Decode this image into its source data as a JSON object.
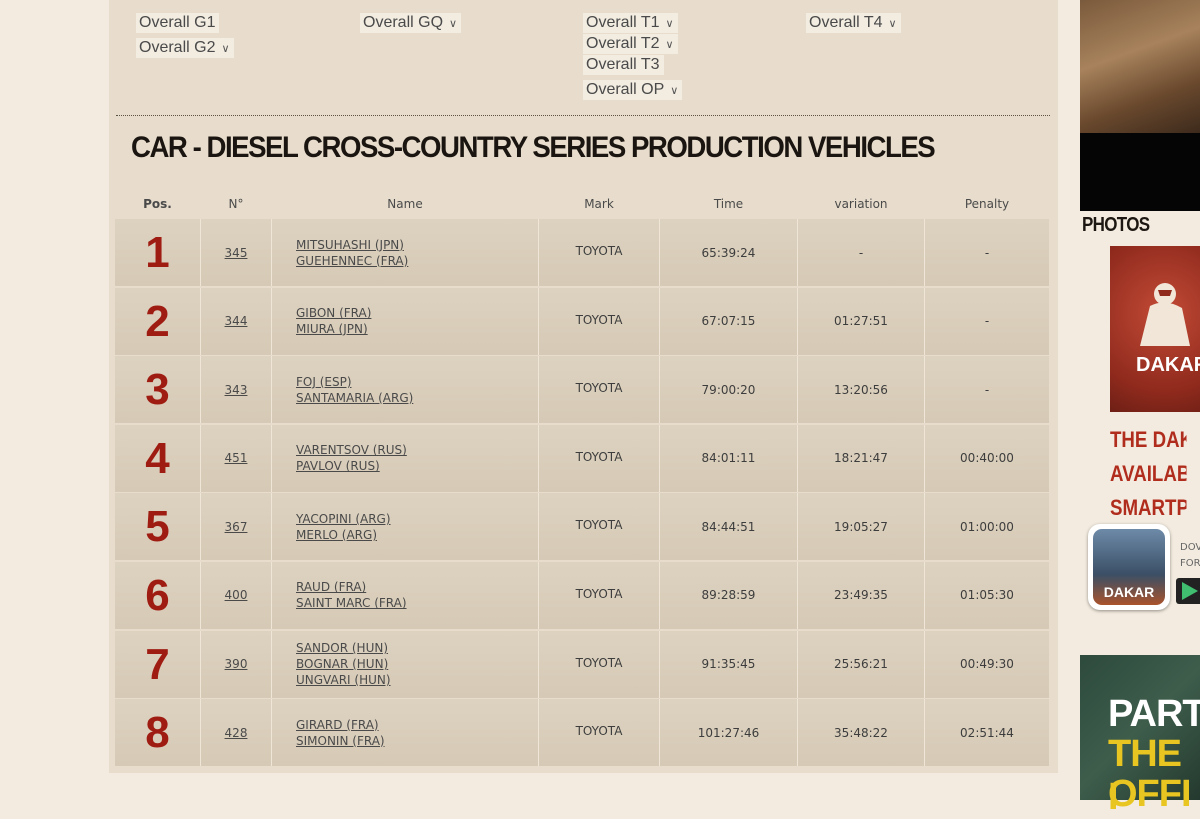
{
  "categories": [
    {
      "label": "Overall G1",
      "dropdown": false
    },
    {
      "label": "Overall G2",
      "dropdown": true
    },
    {
      "label": "Overall GQ",
      "dropdown": true
    },
    {
      "label": "Overall T1",
      "dropdown": true
    },
    {
      "label": "Overall T2",
      "dropdown": true
    },
    {
      "label": "Overall T3",
      "dropdown": false
    },
    {
      "label": "Overall OP",
      "dropdown": true
    },
    {
      "label": "Overall T4",
      "dropdown": true
    }
  ],
  "section_title": "CAR - DIESEL CROSS-COUNTRY SERIES PRODUCTION VEHICLES",
  "table": {
    "headers": {
      "pos": "Pos.",
      "num": "N°",
      "name": "Name",
      "mark": "Mark",
      "time": "Time",
      "variation": "variation",
      "penalty": "Penalty"
    },
    "rows": [
      {
        "pos": "1",
        "num": "345",
        "names": [
          "MITSUHASHI (JPN)",
          "GUEHENNEC (FRA)"
        ],
        "mark": "TOYOTA",
        "time": "65:39:24",
        "variation": "-",
        "penalty": "-"
      },
      {
        "pos": "2",
        "num": "344",
        "names": [
          "GIBON (FRA)",
          "MIURA (JPN)"
        ],
        "mark": "TOYOTA",
        "time": "67:07:15",
        "variation": "01:27:51",
        "penalty": "-"
      },
      {
        "pos": "3",
        "num": "343",
        "names": [
          "FOJ (ESP)",
          "SANTAMARIA (ARG)"
        ],
        "mark": "TOYOTA",
        "time": "79:00:20",
        "variation": "13:20:56",
        "penalty": "-"
      },
      {
        "pos": "4",
        "num": "451",
        "names": [
          "VARENTSOV (RUS)",
          "PAVLOV (RUS)"
        ],
        "mark": "TOYOTA",
        "time": "84:01:11",
        "variation": "18:21:47",
        "penalty": "00:40:00"
      },
      {
        "pos": "5",
        "num": "367",
        "names": [
          "YACOPINI (ARG)",
          "MERLO (ARG)"
        ],
        "mark": "TOYOTA",
        "time": "84:44:51",
        "variation": "19:05:27",
        "penalty": "01:00:00"
      },
      {
        "pos": "6",
        "num": "400",
        "names": [
          "RAUD (FRA)",
          "SAINT MARC (FRA)"
        ],
        "mark": "TOYOTA",
        "time": "89:28:59",
        "variation": "23:49:35",
        "penalty": "01:05:30"
      },
      {
        "pos": "7",
        "num": "390",
        "names": [
          "SANDOR (HUN)",
          "BOGNAR (HUN)",
          "UNGVARI (HUN)"
        ],
        "mark": "TOYOTA",
        "time": "91:35:45",
        "variation": "25:56:21",
        "penalty": "00:49:30"
      },
      {
        "pos": "8",
        "num": "428",
        "names": [
          "GIRARD (FRA)",
          "SIMONIN (FRA)"
        ],
        "mark": "TOYOTA",
        "time": "101:27:46",
        "variation": "35:48:22",
        "penalty": "02:51:44"
      }
    ]
  },
  "sidebar": {
    "photos_label": "PHOTOS",
    "dakar_logo_text": "DAKAR",
    "promo_lines": [
      "THE DAKA",
      "AVAILABL",
      "SMARTPH"
    ],
    "app_label": "DAKAR",
    "download_lines": [
      "DOV",
      "FOR"
    ],
    "ad_lines": [
      "PART",
      "THE I",
      "OFFI"
    ]
  },
  "colors": {
    "position_red": "#9f1c12",
    "panel_bg": "#e8ddcc",
    "row_bg": "#d9cdb9",
    "promo_red": "#b02d1e"
  }
}
